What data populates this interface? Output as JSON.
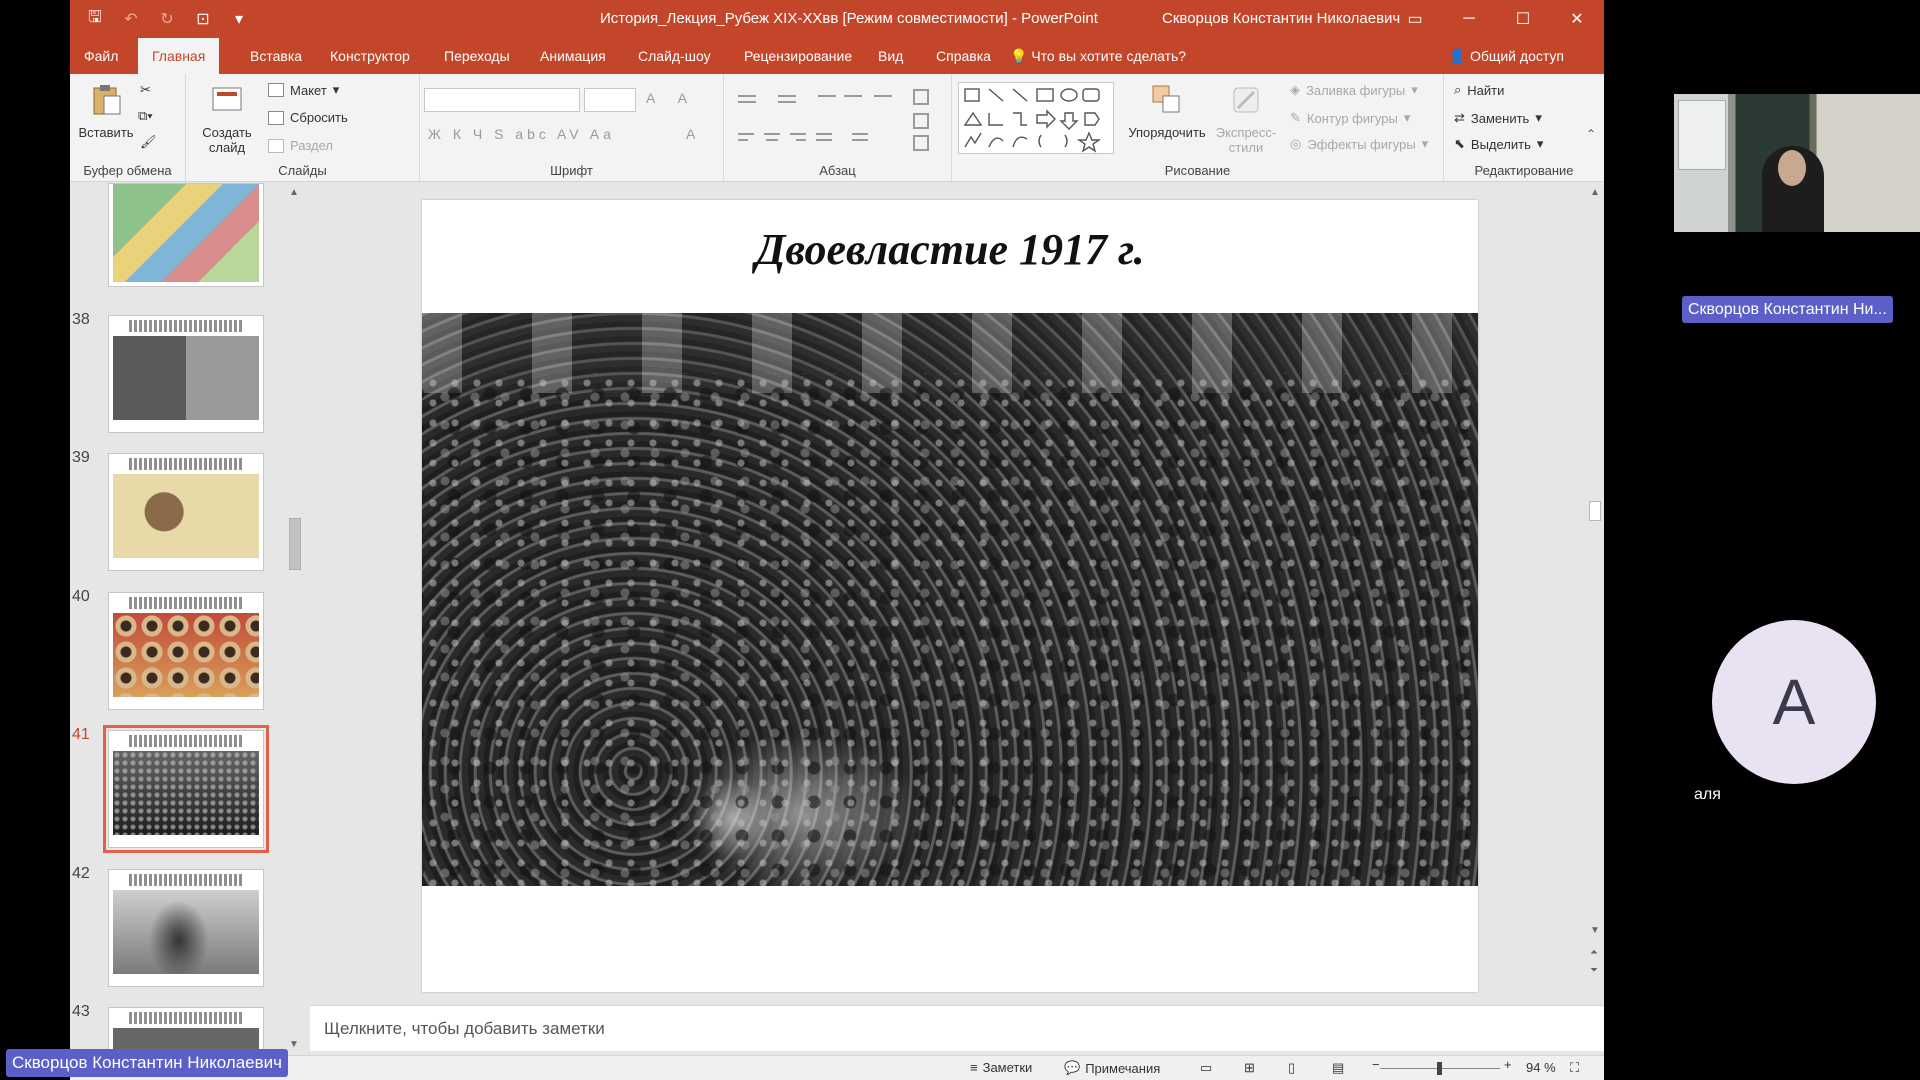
{
  "window": {
    "title": "История_Лекция_Рубеж XIX-XXвв [Режим совместимости]  -  PowerPoint",
    "user": "Скворцов Константин Николаевич"
  },
  "tabs": [
    "Файл",
    "Главная",
    "Вставка",
    "Конструктор",
    "Переходы",
    "Анимация",
    "Слайд-шоу",
    "Рецензирование",
    "Вид",
    "Справка"
  ],
  "active_tab": "Главная",
  "tell_me": "Что вы хотите сделать?",
  "share": "Общий доступ",
  "ribbon": {
    "clipboard": {
      "paste": "Вставить",
      "label": "Буфер обмена"
    },
    "slides": {
      "new_slide_line1": "Создать",
      "new_slide_line2": "слайд",
      "layout": "Макет",
      "reset": "Сбросить",
      "section": "Раздел",
      "label": "Слайды"
    },
    "font": {
      "label": "Шрифт",
      "row1": "A A",
      "row2": "Ж К Ч S abc AV Aa",
      "row2_b": "A"
    },
    "paragraph": {
      "label": "Абзац"
    },
    "drawing": {
      "arrange": "Упорядочить",
      "quick_styles_line1": "Экспресс-",
      "quick_styles_line2": "стили",
      "shape_fill": "Заливка фигуры",
      "shape_outline": "Контур фигуры",
      "shape_effects": "Эффекты фигуры",
      "label": "Рисование"
    },
    "editing": {
      "find": "Найти",
      "replace": "Заменить",
      "select": "Выделить",
      "label": "Редактирование"
    }
  },
  "slides_panel": {
    "numbers": [
      "38",
      "39",
      "40",
      "41",
      "42",
      "43"
    ],
    "selected": "41"
  },
  "slide": {
    "title": "Двоевластие 1917 г."
  },
  "notes_placeholder": "Щелкните, чтобы добавить заметки",
  "statusbar": {
    "notes": "Заметки",
    "comments": "Примечания",
    "zoom": "94 %"
  },
  "conference": {
    "presenter_tile_name": "Скворцов Константин Ни...",
    "participant_initial": "А",
    "participant_name": "аля",
    "active_speaker": "Скворцов Константин Николаевич"
  },
  "colors": {
    "ppt_accent": "#c4462a",
    "name_pill": "#5b5fc7",
    "selected_thumb": "#e0604a"
  }
}
